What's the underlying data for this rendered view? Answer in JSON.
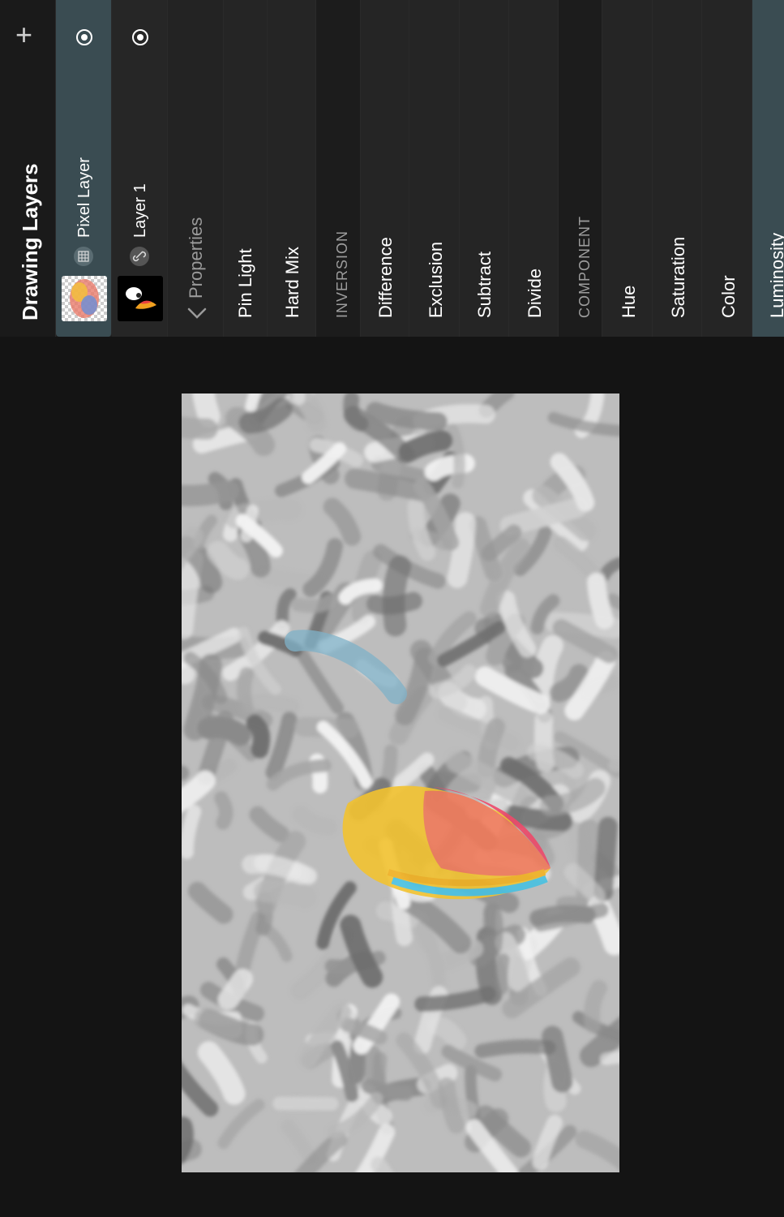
{
  "panel": {
    "title": "Drawing Layers",
    "add_label": "+",
    "layers": [
      {
        "name": "Pixel Layer",
        "type_icon": "grid-icon",
        "visibility_icon": "eye-icon",
        "selected": true
      },
      {
        "name": "Layer 1",
        "type_icon": "link-icon",
        "visibility_icon": "eye-icon",
        "selected": false
      }
    ],
    "properties_label": "Properties",
    "blend_modes": {
      "pin_light": "Pin Light",
      "hard_mix": "Hard Mix",
      "inversion_header": "INVERSION",
      "difference": "Difference",
      "exclusion": "Exclusion",
      "subtract": "Subtract",
      "divide": "Divide",
      "component_header": "COMPONENT",
      "hue": "Hue",
      "saturation": "Saturation",
      "color": "Color",
      "luminosity": "Luminosity"
    },
    "selected_blend_mode": "Luminosity"
  },
  "colors": {
    "selected": "#3a4c52",
    "background": "#141414",
    "panel": "#1f1f1f"
  }
}
